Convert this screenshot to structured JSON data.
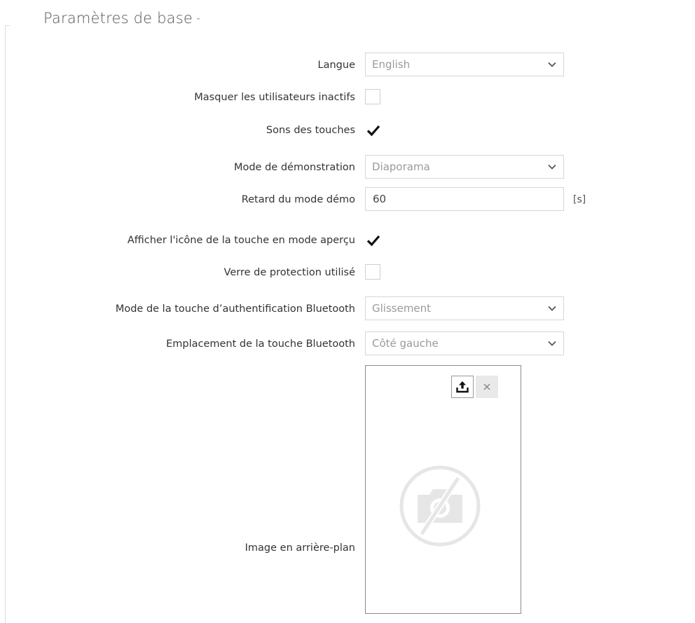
{
  "section": {
    "title": "Paramètres de base"
  },
  "fields": {
    "language": {
      "label": "Langue",
      "value": "English"
    },
    "hide_inactive_users": {
      "label": "Masquer les utilisateurs inactifs",
      "checked": false
    },
    "key_sounds": {
      "label": "Sons des touches",
      "checked": true
    },
    "demo_mode": {
      "label": "Mode de démonstration",
      "value": "Diaporama"
    },
    "demo_delay": {
      "label": "Retard du mode démo",
      "value": "60",
      "unit": "[s]"
    },
    "show_key_icon_preview": {
      "label": "Afficher l'icône de la touche en mode aperçu",
      "checked": true
    },
    "protective_glass": {
      "label": "Verre de protection utilisé",
      "checked": false
    },
    "bluetooth_auth_key_mode": {
      "label": "Mode de la touche d’authentification Bluetooth",
      "value": "Glissement"
    },
    "bluetooth_key_location": {
      "label": "Emplacement de la touche Bluetooth",
      "value": "Côté gauche"
    },
    "background_image": {
      "label": "Image en arrière-plan"
    }
  },
  "icons": {
    "upload": "upload-icon",
    "remove": "close-icon",
    "placeholder": "no-image-camera-icon",
    "dropdown": "chevron-down-icon",
    "check": "checkmark-icon"
  },
  "colors": {
    "text": "#333333",
    "muted_value": "#9a9a9a",
    "border": "#d6d6d6"
  }
}
